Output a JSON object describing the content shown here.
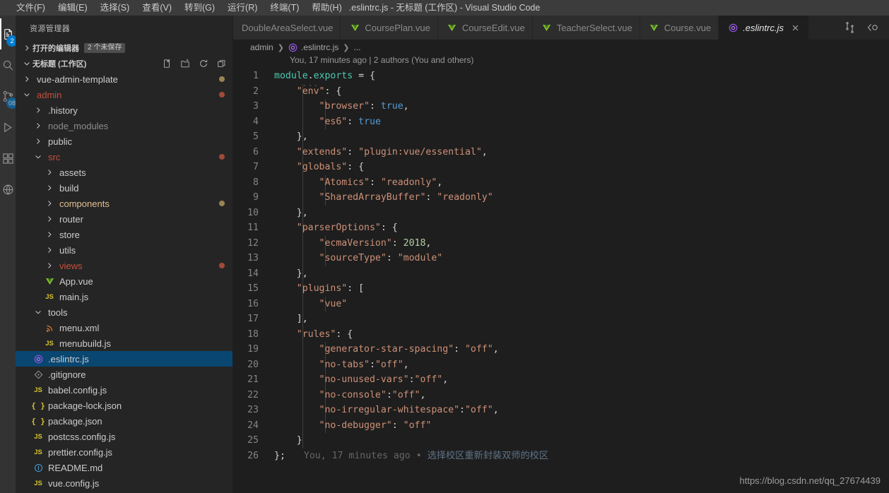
{
  "window": {
    "title": ".eslintrc.js - 无标题 (工作区) - Visual Studio Code"
  },
  "menubar": {
    "items": [
      {
        "label": "文件(F)"
      },
      {
        "label": "编辑(E)"
      },
      {
        "label": "选择(S)"
      },
      {
        "label": "查看(V)"
      },
      {
        "label": "转到(G)"
      },
      {
        "label": "运行(R)"
      },
      {
        "label": "终端(T)"
      },
      {
        "label": "帮助(H)"
      }
    ]
  },
  "activitybar": {
    "items": [
      {
        "name": "explorer-icon",
        "badge": "2",
        "active": true
      },
      {
        "name": "search-icon",
        "badge": ""
      },
      {
        "name": "source-control-icon",
        "badge": "08"
      },
      {
        "name": "run-debug-icon",
        "badge": ""
      },
      {
        "name": "extensions-icon",
        "badge": ""
      },
      {
        "name": "remote-explorer-icon",
        "badge": ""
      }
    ]
  },
  "sidebar": {
    "title": "资源管理器",
    "open_editors": {
      "label": "打开的编辑器",
      "badge": "2 个未保存"
    },
    "workspace": {
      "label": "无标题 (工作区)",
      "actions": [
        "new-file-icon",
        "new-folder-icon",
        "refresh-icon",
        "collapse-all-icon"
      ]
    },
    "tree": [
      {
        "label": "vue-admin-template",
        "type": "folder",
        "expanded": false,
        "depth": 1,
        "color": "normal",
        "dot": "mod"
      },
      {
        "label": "admin",
        "type": "folder",
        "expanded": true,
        "depth": 1,
        "color": "del",
        "dot": "del"
      },
      {
        "label": ".history",
        "type": "folder",
        "expanded": false,
        "depth": 2,
        "color": "normal",
        "dot": ""
      },
      {
        "label": "node_modules",
        "type": "folder",
        "expanded": false,
        "depth": 2,
        "color": "dim",
        "dot": ""
      },
      {
        "label": "public",
        "type": "folder",
        "expanded": false,
        "depth": 2,
        "color": "normal",
        "dot": ""
      },
      {
        "label": "src",
        "type": "folder",
        "expanded": true,
        "depth": 2,
        "color": "del",
        "dot": "del"
      },
      {
        "label": "assets",
        "type": "folder",
        "expanded": false,
        "depth": 3,
        "color": "normal",
        "dot": ""
      },
      {
        "label": "build",
        "type": "folder",
        "expanded": false,
        "depth": 3,
        "color": "normal",
        "dot": ""
      },
      {
        "label": "components",
        "type": "folder",
        "expanded": false,
        "depth": 3,
        "color": "mod",
        "dot": "mod"
      },
      {
        "label": "router",
        "type": "folder",
        "expanded": false,
        "depth": 3,
        "color": "normal",
        "dot": ""
      },
      {
        "label": "store",
        "type": "folder",
        "expanded": false,
        "depth": 3,
        "color": "normal",
        "dot": ""
      },
      {
        "label": "utils",
        "type": "folder",
        "expanded": false,
        "depth": 3,
        "color": "normal",
        "dot": ""
      },
      {
        "label": "views",
        "type": "folder",
        "expanded": false,
        "depth": 3,
        "color": "del",
        "dot": "del"
      },
      {
        "label": "App.vue",
        "type": "file",
        "icon": "vue-icon",
        "depth": 3,
        "color": "normal",
        "dot": ""
      },
      {
        "label": "main.js",
        "type": "file",
        "icon": "js-icon",
        "depth": 3,
        "color": "normal",
        "dot": ""
      },
      {
        "label": "tools",
        "type": "folder",
        "expanded": true,
        "depth": 2,
        "color": "normal",
        "dot": ""
      },
      {
        "label": "menu.xml",
        "type": "file",
        "icon": "xml-icon",
        "depth": 3,
        "color": "normal",
        "dot": ""
      },
      {
        "label": "menubuild.js",
        "type": "file",
        "icon": "js-icon",
        "depth": 3,
        "color": "normal",
        "dot": ""
      },
      {
        "label": ".eslintrc.js",
        "type": "file",
        "icon": "eslint-icon",
        "depth": 2,
        "color": "normal",
        "dot": "",
        "selected": true
      },
      {
        "label": ".gitignore",
        "type": "file",
        "icon": "git-icon",
        "depth": 2,
        "color": "normal",
        "dot": ""
      },
      {
        "label": "babel.config.js",
        "type": "file",
        "icon": "js-icon",
        "depth": 2,
        "color": "normal",
        "dot": ""
      },
      {
        "label": "package-lock.json",
        "type": "file",
        "icon": "json-icon",
        "depth": 2,
        "color": "normal",
        "dot": ""
      },
      {
        "label": "package.json",
        "type": "file",
        "icon": "json-icon",
        "depth": 2,
        "color": "normal",
        "dot": ""
      },
      {
        "label": "postcss.config.js",
        "type": "file",
        "icon": "js-icon",
        "depth": 2,
        "color": "normal",
        "dot": ""
      },
      {
        "label": "prettier.config.js",
        "type": "file",
        "icon": "js-icon",
        "depth": 2,
        "color": "normal",
        "dot": ""
      },
      {
        "label": "README.md",
        "type": "file",
        "icon": "md-icon",
        "depth": 2,
        "color": "normal",
        "dot": ""
      },
      {
        "label": "vue.config.js",
        "type": "file",
        "icon": "js-icon",
        "depth": 2,
        "color": "normal",
        "dot": ""
      }
    ]
  },
  "editor": {
    "tabs": [
      {
        "label": "DoubleAreaSelect.vue",
        "icon": "",
        "active": false
      },
      {
        "label": "CoursePlan.vue",
        "icon": "vue-icon",
        "active": false
      },
      {
        "label": "CourseEdit.vue",
        "icon": "vue-icon",
        "active": false
      },
      {
        "label": "TeacherSelect.vue",
        "icon": "vue-icon",
        "active": false
      },
      {
        "label": "Course.vue",
        "icon": "vue-icon",
        "active": false
      },
      {
        "label": ".eslintrc.js",
        "icon": "eslint-icon",
        "active": true
      }
    ],
    "tab_actions": [
      "split-editor-icon",
      "open-changes-icon"
    ],
    "breadcrumb": [
      {
        "label": "admin",
        "icon": ""
      },
      {
        "label": ".eslintrc.js",
        "icon": "eslint-icon"
      },
      {
        "label": "...",
        "icon": ""
      }
    ],
    "codelens": "You, 17 minutes ago | 2 authors (You and others)",
    "blame": {
      "author": "You, 17 minutes ago",
      "separator": "•",
      "message": "选择校区重新封装双师的校区"
    },
    "lines": [
      {
        "n": "1",
        "tokens": [
          [
            "t-mod",
            "module"
          ],
          [
            "t-punc",
            "."
          ],
          [
            "t-mod",
            "exports"
          ],
          [
            "t-white",
            " = "
          ],
          [
            "t-punc",
            "{"
          ]
        ]
      },
      {
        "n": "2",
        "tokens": [
          [
            "t-white",
            "    "
          ],
          [
            "t-prop",
            "\"env\""
          ],
          [
            "t-punc",
            ": "
          ],
          [
            "t-punc",
            "{"
          ]
        ]
      },
      {
        "n": "3",
        "tokens": [
          [
            "t-white",
            "        "
          ],
          [
            "t-prop",
            "\"browser\""
          ],
          [
            "t-punc",
            ": "
          ],
          [
            "t-bool",
            "true"
          ],
          [
            "t-punc",
            ","
          ]
        ]
      },
      {
        "n": "4",
        "tokens": [
          [
            "t-white",
            "        "
          ],
          [
            "t-prop",
            "\"es6\""
          ],
          [
            "t-punc",
            ": "
          ],
          [
            "t-bool",
            "true"
          ]
        ]
      },
      {
        "n": "5",
        "tokens": [
          [
            "t-white",
            "    "
          ],
          [
            "t-punc",
            "},"
          ]
        ]
      },
      {
        "n": "6",
        "tokens": [
          [
            "t-white",
            "    "
          ],
          [
            "t-prop",
            "\"extends\""
          ],
          [
            "t-punc",
            ": "
          ],
          [
            "t-str",
            "\"plugin:vue/essential\""
          ],
          [
            "t-punc",
            ","
          ]
        ]
      },
      {
        "n": "7",
        "tokens": [
          [
            "t-white",
            "    "
          ],
          [
            "t-prop",
            "\"globals\""
          ],
          [
            "t-punc",
            ": "
          ],
          [
            "t-punc",
            "{"
          ]
        ]
      },
      {
        "n": "8",
        "tokens": [
          [
            "t-white",
            "        "
          ],
          [
            "t-prop",
            "\"Atomics\""
          ],
          [
            "t-punc",
            ": "
          ],
          [
            "t-str",
            "\"readonly\""
          ],
          [
            "t-punc",
            ","
          ]
        ]
      },
      {
        "n": "9",
        "tokens": [
          [
            "t-white",
            "        "
          ],
          [
            "t-prop",
            "\"SharedArrayBuffer\""
          ],
          [
            "t-punc",
            ": "
          ],
          [
            "t-str",
            "\"readonly\""
          ]
        ]
      },
      {
        "n": "10",
        "tokens": [
          [
            "t-white",
            "    "
          ],
          [
            "t-punc",
            "},"
          ]
        ]
      },
      {
        "n": "11",
        "tokens": [
          [
            "t-white",
            "    "
          ],
          [
            "t-prop",
            "\"parserOptions\""
          ],
          [
            "t-punc",
            ": "
          ],
          [
            "t-punc",
            "{"
          ]
        ]
      },
      {
        "n": "12",
        "tokens": [
          [
            "t-white",
            "        "
          ],
          [
            "t-prop",
            "\"ecmaVersion\""
          ],
          [
            "t-punc",
            ": "
          ],
          [
            "t-num",
            "2018"
          ],
          [
            "t-punc",
            ","
          ]
        ]
      },
      {
        "n": "13",
        "tokens": [
          [
            "t-white",
            "        "
          ],
          [
            "t-prop",
            "\"sourceType\""
          ],
          [
            "t-punc",
            ": "
          ],
          [
            "t-str",
            "\"module\""
          ]
        ]
      },
      {
        "n": "14",
        "tokens": [
          [
            "t-white",
            "    "
          ],
          [
            "t-punc",
            "},"
          ]
        ]
      },
      {
        "n": "15",
        "tokens": [
          [
            "t-white",
            "    "
          ],
          [
            "t-prop",
            "\"plugins\""
          ],
          [
            "t-punc",
            ": "
          ],
          [
            "t-punc",
            "["
          ]
        ]
      },
      {
        "n": "16",
        "tokens": [
          [
            "t-white",
            "        "
          ],
          [
            "t-str",
            "\"vue\""
          ]
        ]
      },
      {
        "n": "17",
        "tokens": [
          [
            "t-white",
            "    "
          ],
          [
            "t-punc",
            "],"
          ]
        ]
      },
      {
        "n": "18",
        "tokens": [
          [
            "t-white",
            "    "
          ],
          [
            "t-prop",
            "\"rules\""
          ],
          [
            "t-punc",
            ": "
          ],
          [
            "t-punc",
            "{"
          ]
        ]
      },
      {
        "n": "19",
        "tokens": [
          [
            "t-white",
            "        "
          ],
          [
            "t-prop",
            "\"generator-star-spacing\""
          ],
          [
            "t-punc",
            ": "
          ],
          [
            "t-str",
            "\"off\""
          ],
          [
            "t-punc",
            ","
          ]
        ]
      },
      {
        "n": "20",
        "tokens": [
          [
            "t-white",
            "        "
          ],
          [
            "t-prop",
            "\"no-tabs\""
          ],
          [
            "t-punc",
            ":"
          ],
          [
            "t-str",
            "\"off\""
          ],
          [
            "t-punc",
            ","
          ]
        ]
      },
      {
        "n": "21",
        "tokens": [
          [
            "t-white",
            "        "
          ],
          [
            "t-prop",
            "\"no-unused-vars\""
          ],
          [
            "t-punc",
            ":"
          ],
          [
            "t-str",
            "\"off\""
          ],
          [
            "t-punc",
            ","
          ]
        ]
      },
      {
        "n": "22",
        "tokens": [
          [
            "t-white",
            "        "
          ],
          [
            "t-prop",
            "\"no-console\""
          ],
          [
            "t-punc",
            ":"
          ],
          [
            "t-str",
            "\"off\""
          ],
          [
            "t-punc",
            ","
          ]
        ]
      },
      {
        "n": "23",
        "tokens": [
          [
            "t-white",
            "        "
          ],
          [
            "t-prop",
            "\"no-irregular-whitespace\""
          ],
          [
            "t-punc",
            ":"
          ],
          [
            "t-str",
            "\"off\""
          ],
          [
            "t-punc",
            ","
          ]
        ]
      },
      {
        "n": "24",
        "tokens": [
          [
            "t-white",
            "        "
          ],
          [
            "t-prop",
            "\"no-debugger\""
          ],
          [
            "t-punc",
            ": "
          ],
          [
            "t-str",
            "\"off\""
          ]
        ]
      },
      {
        "n": "25",
        "tokens": [
          [
            "t-white",
            "    "
          ],
          [
            "t-punc",
            "}"
          ]
        ]
      },
      {
        "n": "26",
        "tokens": [
          [
            "t-punc",
            "};"
          ]
        ]
      }
    ]
  },
  "watermark": "https://blog.csdn.net/qq_27674439",
  "colors": {
    "accent": "#007acc",
    "selection": "#094771",
    "titlebar": "#3c3c3c",
    "sidebar": "#252526",
    "editor": "#1e1e1e",
    "activitybar": "#333333",
    "modified": "#e2c08d",
    "deleted": "#c74e39"
  }
}
